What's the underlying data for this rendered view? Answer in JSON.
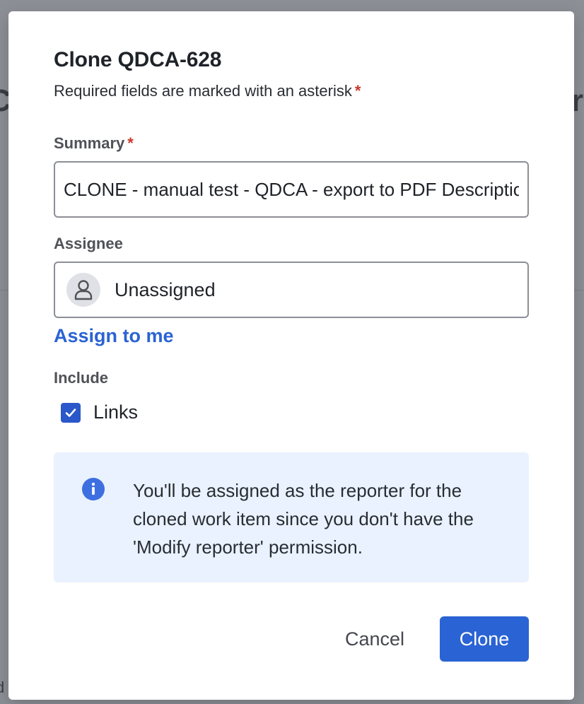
{
  "dialog": {
    "title": "Clone QDCA-628",
    "subtitle": "Required fields are marked with an asterisk",
    "required_mark": "*"
  },
  "summary": {
    "label": "Summary",
    "value": "CLONE - manual test - QDCA - export to PDF Description"
  },
  "assignee": {
    "label": "Assignee",
    "value": "Unassigned",
    "assign_to_me": "Assign to me"
  },
  "include": {
    "label": "Include",
    "links_label": "Links",
    "links_checked": true
  },
  "info": {
    "icon": "info-icon",
    "message": "You'll be assigned as the reporter for the cloned work item since you don't have the 'Modify reporter' permission."
  },
  "buttons": {
    "cancel": "Cancel",
    "clone": "Clone"
  },
  "colors": {
    "primary": "#2a63d4",
    "required": "#c9372c",
    "info_bg": "#e9f2fe"
  }
}
